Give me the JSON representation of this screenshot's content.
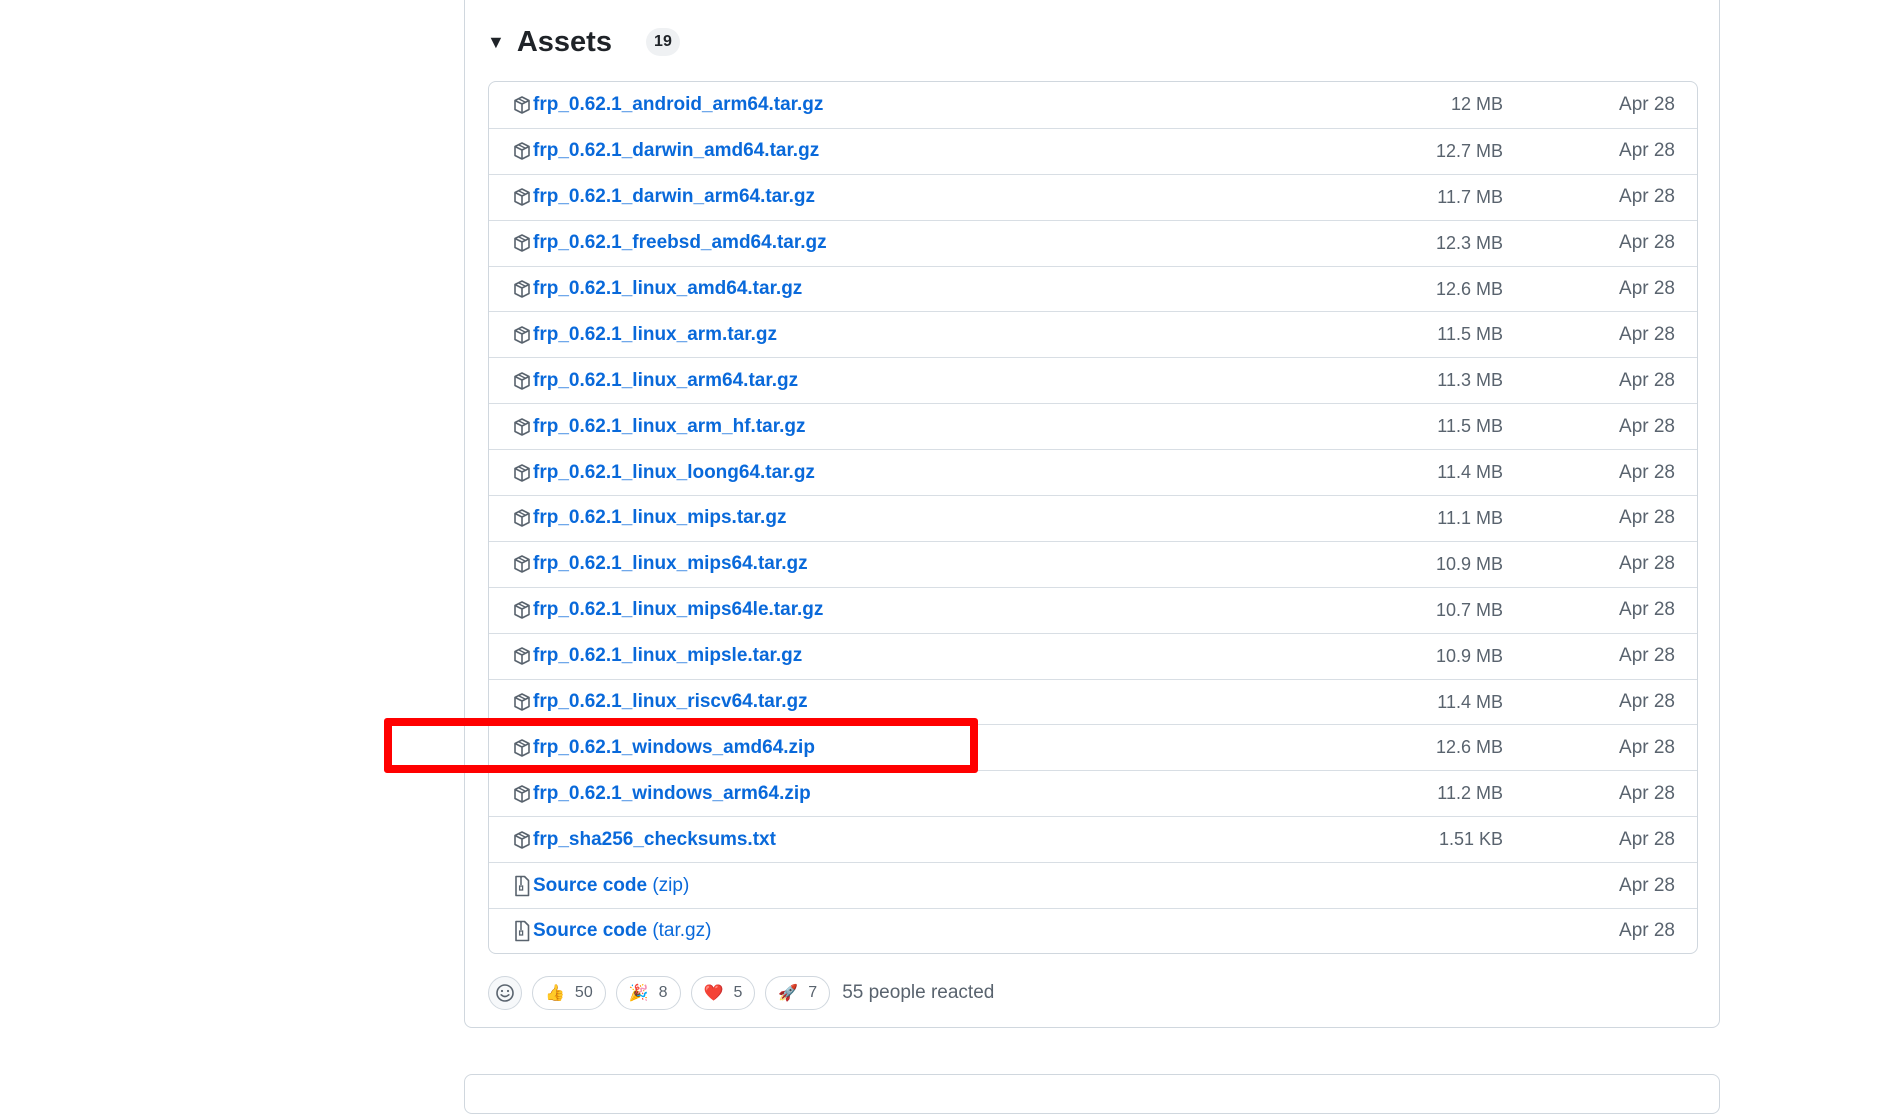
{
  "assets": {
    "title": "Assets",
    "count": "19",
    "items": [
      {
        "name": "frp_0.62.1_android_arm64.tar.gz",
        "size": "12 MB",
        "date": "Apr 28",
        "icon": "package-icon"
      },
      {
        "name": "frp_0.62.1_darwin_amd64.tar.gz",
        "size": "12.7 MB",
        "date": "Apr 28",
        "icon": "package-icon"
      },
      {
        "name": "frp_0.62.1_darwin_arm64.tar.gz",
        "size": "11.7 MB",
        "date": "Apr 28",
        "icon": "package-icon"
      },
      {
        "name": "frp_0.62.1_freebsd_amd64.tar.gz",
        "size": "12.3 MB",
        "date": "Apr 28",
        "icon": "package-icon"
      },
      {
        "name": "frp_0.62.1_linux_amd64.tar.gz",
        "size": "12.6 MB",
        "date": "Apr 28",
        "icon": "package-icon"
      },
      {
        "name": "frp_0.62.1_linux_arm.tar.gz",
        "size": "11.5 MB",
        "date": "Apr 28",
        "icon": "package-icon"
      },
      {
        "name": "frp_0.62.1_linux_arm64.tar.gz",
        "size": "11.3 MB",
        "date": "Apr 28",
        "icon": "package-icon"
      },
      {
        "name": "frp_0.62.1_linux_arm_hf.tar.gz",
        "size": "11.5 MB",
        "date": "Apr 28",
        "icon": "package-icon"
      },
      {
        "name": "frp_0.62.1_linux_loong64.tar.gz",
        "size": "11.4 MB",
        "date": "Apr 28",
        "icon": "package-icon"
      },
      {
        "name": "frp_0.62.1_linux_mips.tar.gz",
        "size": "11.1 MB",
        "date": "Apr 28",
        "icon": "package-icon"
      },
      {
        "name": "frp_0.62.1_linux_mips64.tar.gz",
        "size": "10.9 MB",
        "date": "Apr 28",
        "icon": "package-icon"
      },
      {
        "name": "frp_0.62.1_linux_mips64le.tar.gz",
        "size": "10.7 MB",
        "date": "Apr 28",
        "icon": "package-icon"
      },
      {
        "name": "frp_0.62.1_linux_mipsle.tar.gz",
        "size": "10.9 MB",
        "date": "Apr 28",
        "icon": "package-icon"
      },
      {
        "name": "frp_0.62.1_linux_riscv64.tar.gz",
        "size": "11.4 MB",
        "date": "Apr 28",
        "icon": "package-icon"
      },
      {
        "name": "frp_0.62.1_windows_amd64.zip",
        "size": "12.6 MB",
        "date": "Apr 28",
        "icon": "package-icon"
      },
      {
        "name": "frp_0.62.1_windows_arm64.zip",
        "size": "11.2 MB",
        "date": "Apr 28",
        "icon": "package-icon"
      },
      {
        "name": "frp_sha256_checksums.txt",
        "size": "1.51 KB",
        "date": "Apr 28",
        "icon": "package-icon"
      },
      {
        "name": "Source code",
        "ext": "(zip)",
        "size": "",
        "date": "Apr 28",
        "icon": "file-zip-icon"
      },
      {
        "name": "Source code",
        "ext": "(tar.gz)",
        "size": "",
        "date": "Apr 28",
        "icon": "file-zip-icon"
      }
    ]
  },
  "highlight": {
    "target": "frp_0.62.1_windows_amd64.zip",
    "color": "#ff0000"
  },
  "reactions": {
    "items": [
      {
        "emoji": "👍",
        "count": "50",
        "icon": "thumbs-up-icon"
      },
      {
        "emoji": "🎉",
        "count": "8",
        "icon": "party-popper-icon"
      },
      {
        "emoji": "❤️",
        "count": "5",
        "icon": "heart-icon"
      },
      {
        "emoji": "🚀",
        "count": "7",
        "icon": "rocket-icon"
      }
    ],
    "summary": "55 people reacted"
  },
  "colors": {
    "link": "#0969da",
    "muted": "#59636e",
    "border": "#d0d7de"
  }
}
